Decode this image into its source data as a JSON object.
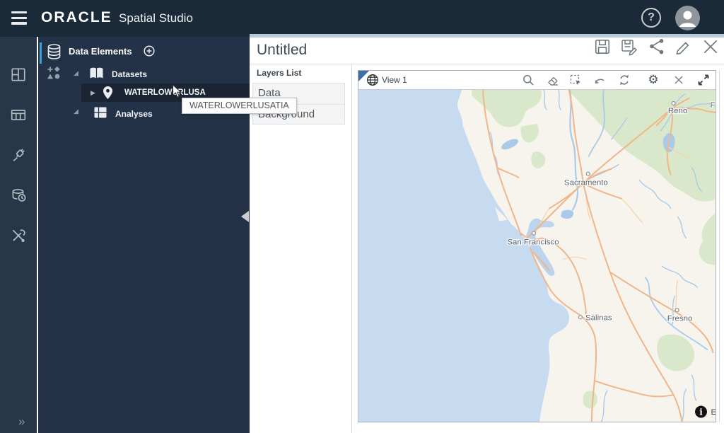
{
  "topbar": {
    "brand": "ORACLE",
    "product": "Spatial Studio"
  },
  "icons": {
    "help_glyph": "?",
    "rail_expand_glyph": "»",
    "gear_glyph": "⚙",
    "expanded_tri_glyph": "◢",
    "collapsed_tri_glyph": "▶",
    "info_glyph": "i"
  },
  "nav_rail": {
    "items": [
      "dashboard",
      "datasets-table",
      "connections-plug",
      "jobs-database-clock",
      "admin-tools"
    ]
  },
  "data_panel": {
    "title": "Data Elements",
    "rail_icons": [
      "database",
      "shapes"
    ],
    "tree": {
      "datasets_label": "Datasets",
      "selected_item": "WATERLOWERLUSA",
      "analyses_label": "Analyses"
    },
    "tooltip": "WATERLOWERLUSATIA"
  },
  "editor": {
    "title": "Untitled",
    "actions": [
      "save",
      "save-as",
      "share",
      "edit",
      "close"
    ]
  },
  "layers_panel": {
    "title": "Layers List",
    "items": [
      "Data",
      "Background"
    ]
  },
  "map_view": {
    "title": "View 1",
    "toolbar": [
      "search",
      "eraser",
      "marquee-select",
      "previous-extent",
      "refresh",
      "settings",
      "close",
      "expand"
    ],
    "cities": {
      "sacramento": "Sacramento",
      "san_francisco": "San Francisco",
      "salinas": "Salinas",
      "fresno": "Fresno",
      "reno": "Reno",
      "fernley_partial": "Fe"
    },
    "attribution": "E",
    "colors": {
      "ocean": "#c6dbf0",
      "land": "#f7f3ed",
      "forest": "#d9e8cb",
      "road_major": "#f0b68a",
      "road_minor": "#f6d5a8",
      "water_line": "#a9cbe9",
      "corner_accent": "#3f6fa5"
    }
  }
}
